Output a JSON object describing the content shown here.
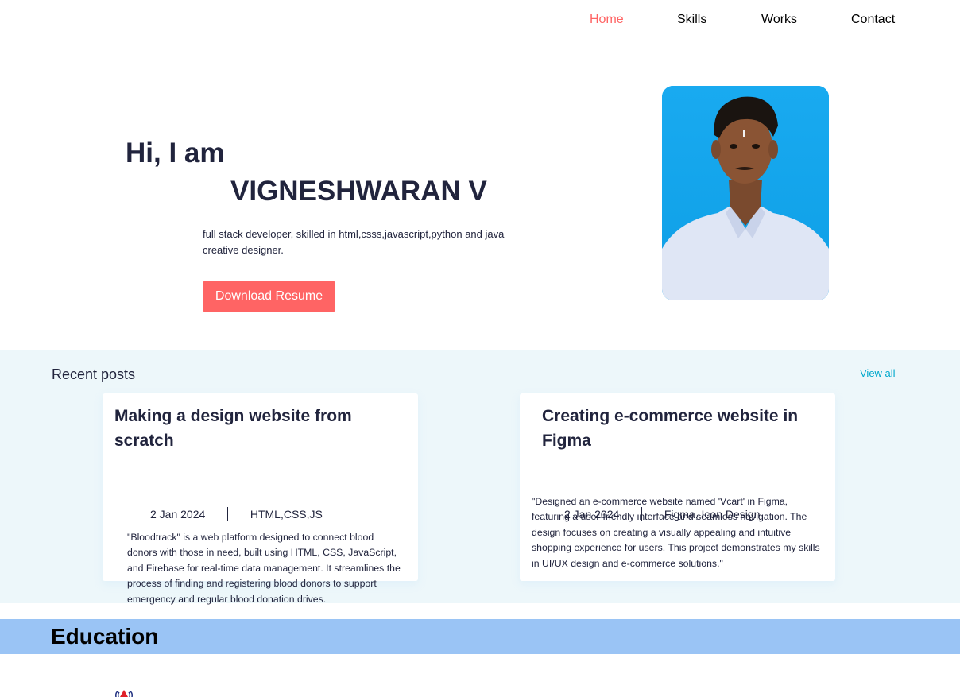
{
  "nav": {
    "items": [
      {
        "label": "Home",
        "active": true
      },
      {
        "label": "Skills",
        "active": false
      },
      {
        "label": "Works",
        "active": false
      },
      {
        "label": "Contact",
        "active": false
      }
    ]
  },
  "hero": {
    "greeting": "Hi, I am",
    "name": "VIGNESHWARAN V",
    "description": "full stack developer, skilled in html,csss,javascript,python and java creative designer.",
    "resume_button": "Download Resume",
    "photo_icon": "profile-photo"
  },
  "posts": {
    "title": "Recent posts",
    "view_all": "View all",
    "items": [
      {
        "title": "Making a design website  from scratch",
        "date": "2  Jan 2024",
        "tags": "HTML,CSS,JS",
        "body": "\"Bloodtrack\" is a web platform designed to connect blood donors with those in need, built using HTML, CSS, JavaScript, and Firebase for real-time data management. It streamlines the process of finding and registering blood donors to support emergency and regular blood donation drives."
      },
      {
        "title": "Creating e-commerce website in Figma",
        "date": "2  Jan 2024",
        "tags": "Figma, Icon Design",
        "body": "\"Designed an e-commerce website named 'Vcart' in Figma, featuring a user-friendly interface and seamless navigation. The design focuses on creating a visually appealing and intuitive shopping experience for users. This project demonstrates my skills in UI/UX design and e-commerce solutions.\""
      }
    ]
  },
  "education": {
    "title": "Education",
    "logo_icon": "college-logo-icon"
  },
  "colors": {
    "accent": "#ff6464",
    "heading": "#21243d",
    "posts_background": "#edf7fa",
    "link": "#00a8cc",
    "education_band": "#9ac4f5"
  }
}
